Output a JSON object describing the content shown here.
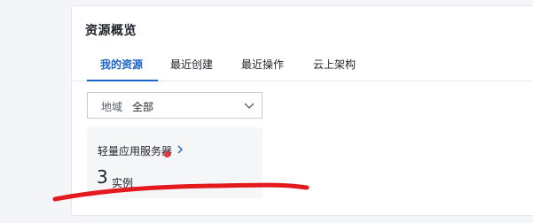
{
  "panel": {
    "title": "资源概览"
  },
  "tabs": [
    {
      "label": "我的资源",
      "active": true
    },
    {
      "label": "最近创建",
      "active": false
    },
    {
      "label": "最近操作",
      "active": false
    },
    {
      "label": "云上架构",
      "active": false
    }
  ],
  "region_filter": {
    "label": "地域",
    "value": "全部"
  },
  "resource_tile": {
    "title": "轻量应用服务器",
    "count": "3",
    "unit": "实例"
  },
  "colors": {
    "accent": "#1a64c8",
    "alert_dot": "#e6383b",
    "annotation": "#e3191e"
  },
  "icons": {
    "dropdown": "chevron-down-icon",
    "tile_link": "chevron-right-icon",
    "status": "status-dot-icon"
  }
}
